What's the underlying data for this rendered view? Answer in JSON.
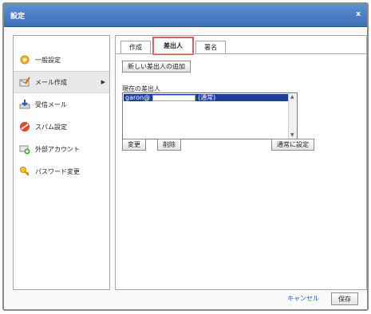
{
  "window": {
    "title": "設定",
    "close_label": "x"
  },
  "sidebar": {
    "items": [
      {
        "label": "一般設定",
        "icon": "gear-icon"
      },
      {
        "label": "メール作成",
        "icon": "pencil-mail-icon",
        "active": true
      },
      {
        "label": "受信メール",
        "icon": "inbox-download-icon"
      },
      {
        "label": "スパム設定",
        "icon": "spam-block-icon"
      },
      {
        "label": "外部アカウント",
        "icon": "external-account-icon"
      },
      {
        "label": "パスワード変更",
        "icon": "key-icon"
      }
    ]
  },
  "tabs": [
    {
      "label": "作成"
    },
    {
      "label": "差出人",
      "active": true
    },
    {
      "label": "署名"
    }
  ],
  "sender": {
    "add_button": "新しい差出人の追加",
    "current_label": "現在の差出人",
    "list": [
      {
        "prefix": "garon@",
        "suffix": "(通常)"
      }
    ],
    "change_button": "変更",
    "delete_button": "削除",
    "set_default_button": "通常に設定"
  },
  "footer": {
    "cancel_label": "キャンセル",
    "save_label": "保存"
  },
  "colors": {
    "title_bar": "#4b7cc4",
    "selected_row": "#1f3fa0",
    "active_tab_border": "#e06060",
    "link": "#2a5db0"
  }
}
